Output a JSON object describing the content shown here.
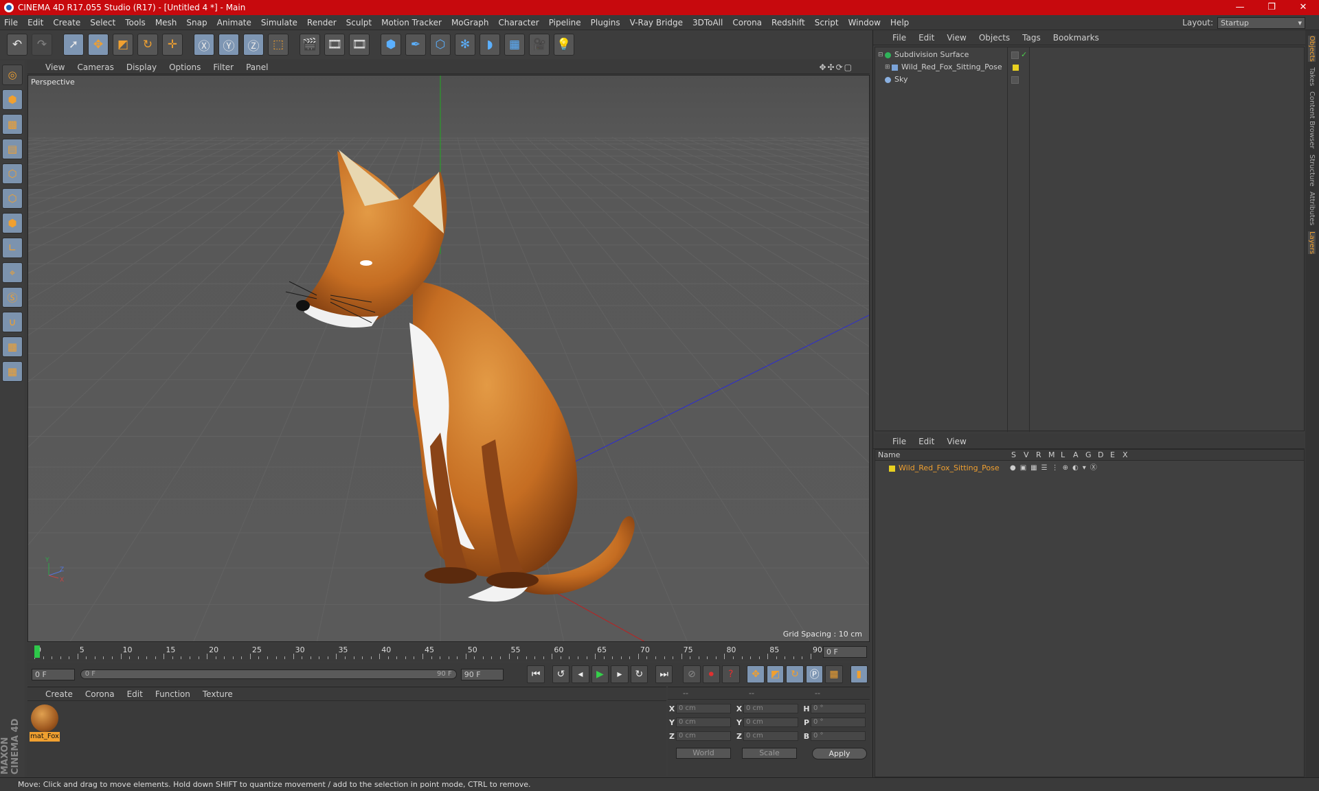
{
  "window": {
    "title": "CINEMA 4D R17.055 Studio (R17) - [Untitled 4 *] - Main",
    "controls": [
      "—",
      "❐",
      "✕"
    ]
  },
  "menu": [
    "File",
    "Edit",
    "Create",
    "Select",
    "Tools",
    "Mesh",
    "Snap",
    "Animate",
    "Simulate",
    "Render",
    "Sculpt",
    "Motion Tracker",
    "MoGraph",
    "Character",
    "Pipeline",
    "Plugins",
    "V-Ray Bridge",
    "3DToAll",
    "Corona",
    "Redshift",
    "Script",
    "Window",
    "Help"
  ],
  "layout": {
    "label": "Layout:",
    "value": "Startup"
  },
  "viewport": {
    "menu": [
      "View",
      "Cameras",
      "Display",
      "Options",
      "Filter",
      "Panel"
    ],
    "label": "Perspective",
    "grid_spacing": "Grid Spacing : 10 cm",
    "axis": {
      "x": "X",
      "y": "Y",
      "z": "Z"
    }
  },
  "timeline": {
    "ticks": [
      "0",
      "5",
      "10",
      "15",
      "20",
      "25",
      "30",
      "35",
      "40",
      "45",
      "50",
      "55",
      "60",
      "65",
      "70",
      "75",
      "80",
      "85",
      "90"
    ],
    "current": "0 F",
    "start": "0 F",
    "end_slider": "90 F",
    "end": "90 F",
    "slider_start": "0 F"
  },
  "material": {
    "menu": [
      "Create",
      "Corona",
      "Edit",
      "Function",
      "Texture"
    ],
    "name": "mat_Fox"
  },
  "coords": {
    "headers": [
      "--",
      "--",
      "--"
    ],
    "rows": [
      [
        "X",
        "0 cm",
        "X",
        "0 cm",
        "H",
        "0 °"
      ],
      [
        "Y",
        "0 cm",
        "Y",
        "0 cm",
        "P",
        "0 °"
      ],
      [
        "Z",
        "0 cm",
        "Z",
        "0 cm",
        "B",
        "0 °"
      ]
    ],
    "world": "World",
    "scale": "Scale",
    "apply": "Apply"
  },
  "objects": {
    "menu": [
      "File",
      "Edit",
      "View",
      "Objects",
      "Tags",
      "Bookmarks"
    ],
    "items": [
      "Subdivision Surface",
      "Wild_Red_Fox_Sitting_Pose",
      "Sky"
    ]
  },
  "layers": {
    "menu": [
      "File",
      "Edit",
      "View"
    ],
    "columns": [
      "Name",
      "S",
      "V",
      "R",
      "M",
      "L",
      "A",
      "G",
      "D",
      "E",
      "X"
    ],
    "item": "Wild_Red_Fox_Sitting_Pose"
  },
  "side_tabs": [
    "Objects",
    "Takes",
    "Content Browser",
    "Structure",
    "Attributes",
    "Layers"
  ],
  "brand": "MAXON CINEMA 4D",
  "status": "Move: Click and drag to move elements. Hold down SHIFT to quantize movement / add to the selection in point mode, CTRL to remove.",
  "colors": {
    "title_bar": "#c7090d",
    "accent": "#f0a030",
    "layer_yellow": "#e8d020"
  }
}
